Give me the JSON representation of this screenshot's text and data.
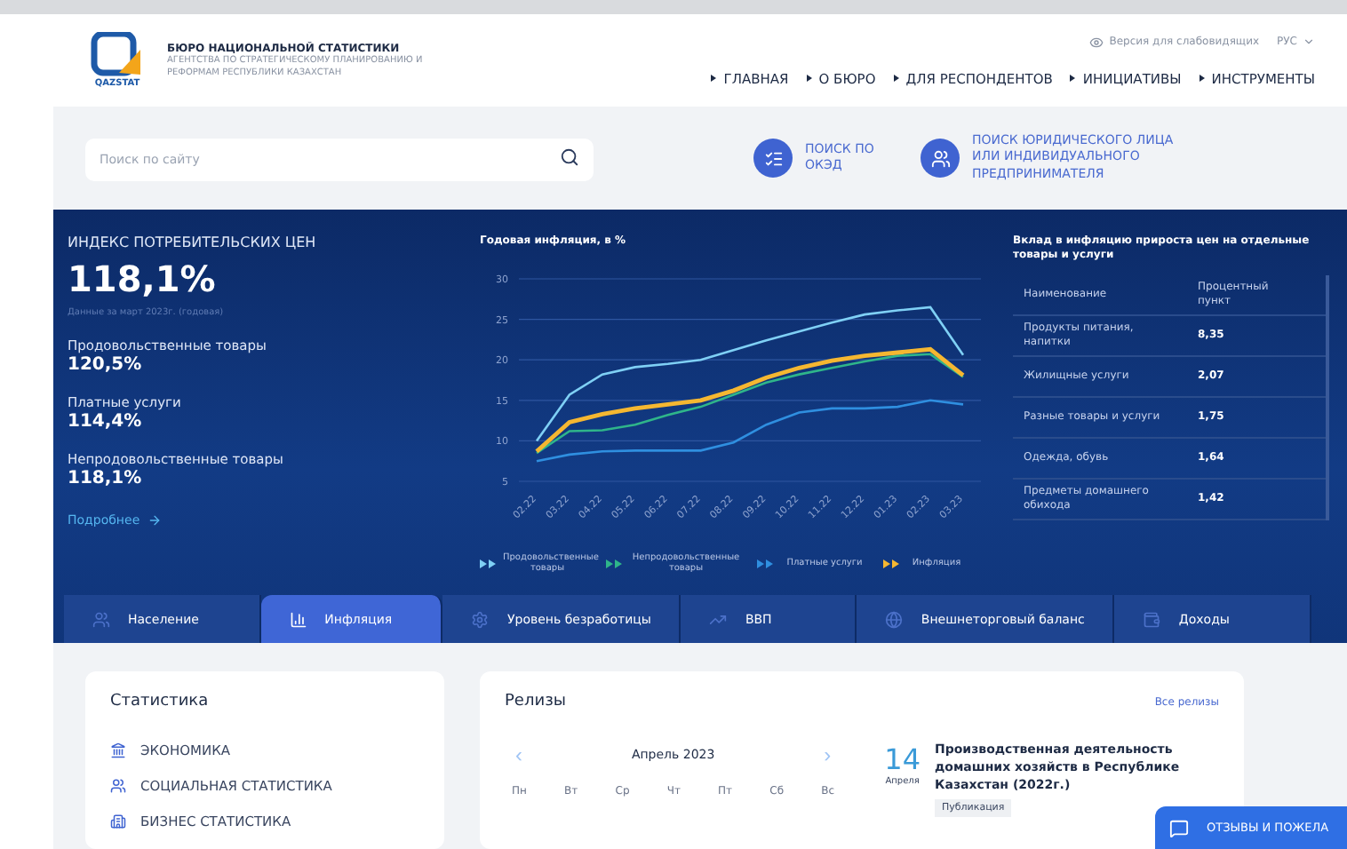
{
  "header": {
    "logo_text": "QAZSTAT",
    "org_title": "БЮРО НАЦИОНАЛЬНОЙ СТАТИСТИКИ",
    "org_subtitle": "АГЕНТСТВА ПО СТРАТЕГИЧЕСКОМУ ПЛАНИРОВАНИЮ И РЕФОРМАМ РЕСПУБЛИКИ КАЗАХСТАН",
    "accessibility_link": "Версия для слабовидящих",
    "language": "РУС",
    "nav": [
      "ГЛАВНАЯ",
      "О БЮРО",
      "ДЛЯ РЕСПОНДЕНТОВ",
      "ИНИЦИАТИВЫ",
      "ИНСТРУМЕНТЫ"
    ]
  },
  "search": {
    "placeholder": "Поиск по сайту",
    "quick_links": [
      {
        "kind": "list",
        "label": "ПОИСК ПО ОКЭД"
      },
      {
        "kind": "people",
        "label": "ПОИСК ЮРИДИЧЕСКОГО ЛИЦА ИЛИ ИНДИВИДУАЛЬНОГО ПРЕДПРИНИМАТЕЛЯ"
      }
    ]
  },
  "cpi": {
    "title": "ИНДЕКС ПОТРЕБИТЕЛЬСКИХ ЦЕН",
    "value": "118,1%",
    "note": "Данные за март 2023г. (годовая)",
    "items": [
      {
        "label": "Продовольственные товары",
        "value": "120,5%"
      },
      {
        "label": "Платные услуги",
        "value": "114,4%"
      },
      {
        "label": "Непродовольственные товары",
        "value": "118,1%"
      }
    ],
    "more_link": "Подробнее"
  },
  "inflation_chart": {
    "chart_data": {
      "type": "line",
      "grid": true,
      "title": "Годовая инфляция, в %",
      "categories": [
        "02.22",
        "03.22",
        "04.22",
        "05.22",
        "06.22",
        "07.22",
        "08.22",
        "09.22",
        "10.22",
        "11.22",
        "12.22",
        "01.23",
        "02.23",
        "03.23"
      ],
      "ylim": [
        5,
        30
      ],
      "yticks": [
        5,
        10,
        15,
        20,
        25,
        30
      ],
      "series": [
        {
          "name": "Продовольственные товары",
          "color": "#7fd0f5",
          "values": [
            10,
            15.7,
            18.2,
            19.1,
            19.5,
            20,
            21.2,
            22.4,
            23.5,
            24.6,
            25.6,
            26.1,
            26.5,
            20.6
          ]
        },
        {
          "name": "Непродовольственные товары",
          "color": "#2fb58a",
          "values": [
            8.5,
            11.2,
            11.3,
            12,
            13.2,
            14.2,
            15.7,
            17.2,
            18.2,
            19,
            19.8,
            20.5,
            20.7,
            17.9
          ]
        },
        {
          "name": "Платные услуги",
          "color": "#2f8fe0",
          "values": [
            7.5,
            8.3,
            8.7,
            8.8,
            8.8,
            8.8,
            9.8,
            12,
            13.5,
            14,
            14,
            14.2,
            15,
            14.5
          ]
        },
        {
          "name": "Инфляция",
          "color": "#f5b731",
          "values": [
            8.7,
            12.3,
            13.3,
            14,
            14.5,
            15,
            16.2,
            17.8,
            19,
            19.9,
            20.5,
            20.9,
            21.3,
            18.1
          ]
        }
      ]
    }
  },
  "contribution": {
    "title": "Вклад в инфляцию прироста цен на отдельные товары и услуги",
    "columns": [
      "Наименование",
      "Процентный пункт"
    ],
    "rows": [
      {
        "name": "Продукты питания, напитки",
        "value": "8,35"
      },
      {
        "name": "Жилищные услуги",
        "value": "2,07"
      },
      {
        "name": "Разные товары и услуги",
        "value": "1,75"
      },
      {
        "name": "Одежда, обувь",
        "value": "1,64"
      },
      {
        "name": "Предметы домашнего обихода",
        "value": "1,42"
      }
    ]
  },
  "tabs": [
    {
      "kind": "people",
      "label": "Население",
      "selected": false
    },
    {
      "kind": "chart",
      "label": "Инфляция",
      "selected": true
    },
    {
      "kind": "gear",
      "label": "Уровень безработицы",
      "selected": false
    },
    {
      "kind": "bars",
      "label": "ВВП",
      "selected": false
    },
    {
      "kind": "globe",
      "label": "Внешнеторговый баланс",
      "selected": false
    },
    {
      "kind": "wallet",
      "label": "Доходы",
      "selected": false
    }
  ],
  "statistics": {
    "title": "Статистика",
    "items": [
      {
        "kind": "bank",
        "label": "ЭКОНОМИКА"
      },
      {
        "kind": "people",
        "label": "СОЦИАЛЬНАЯ СТАТИСТИКА"
      },
      {
        "kind": "building",
        "label": "БИЗНЕС СТАТИСТИКА"
      }
    ]
  },
  "releases": {
    "title": "Релизы",
    "all_link": "Все релизы",
    "calendar": {
      "prev": "‹",
      "month": "Апрель 2023",
      "next": "›",
      "weekdays": [
        "Пн",
        "Вт",
        "Ср",
        "Чт",
        "Пт",
        "Сб",
        "Вс"
      ]
    },
    "release": {
      "day": "14",
      "month": "Апреля",
      "title": "Производственная деятельность домашних хозяйств в Республике Казахстан (2022г.)",
      "tag": "Публикация"
    }
  },
  "feedback_button": "ОТЗЫВЫ И ПОЖЕЛА"
}
